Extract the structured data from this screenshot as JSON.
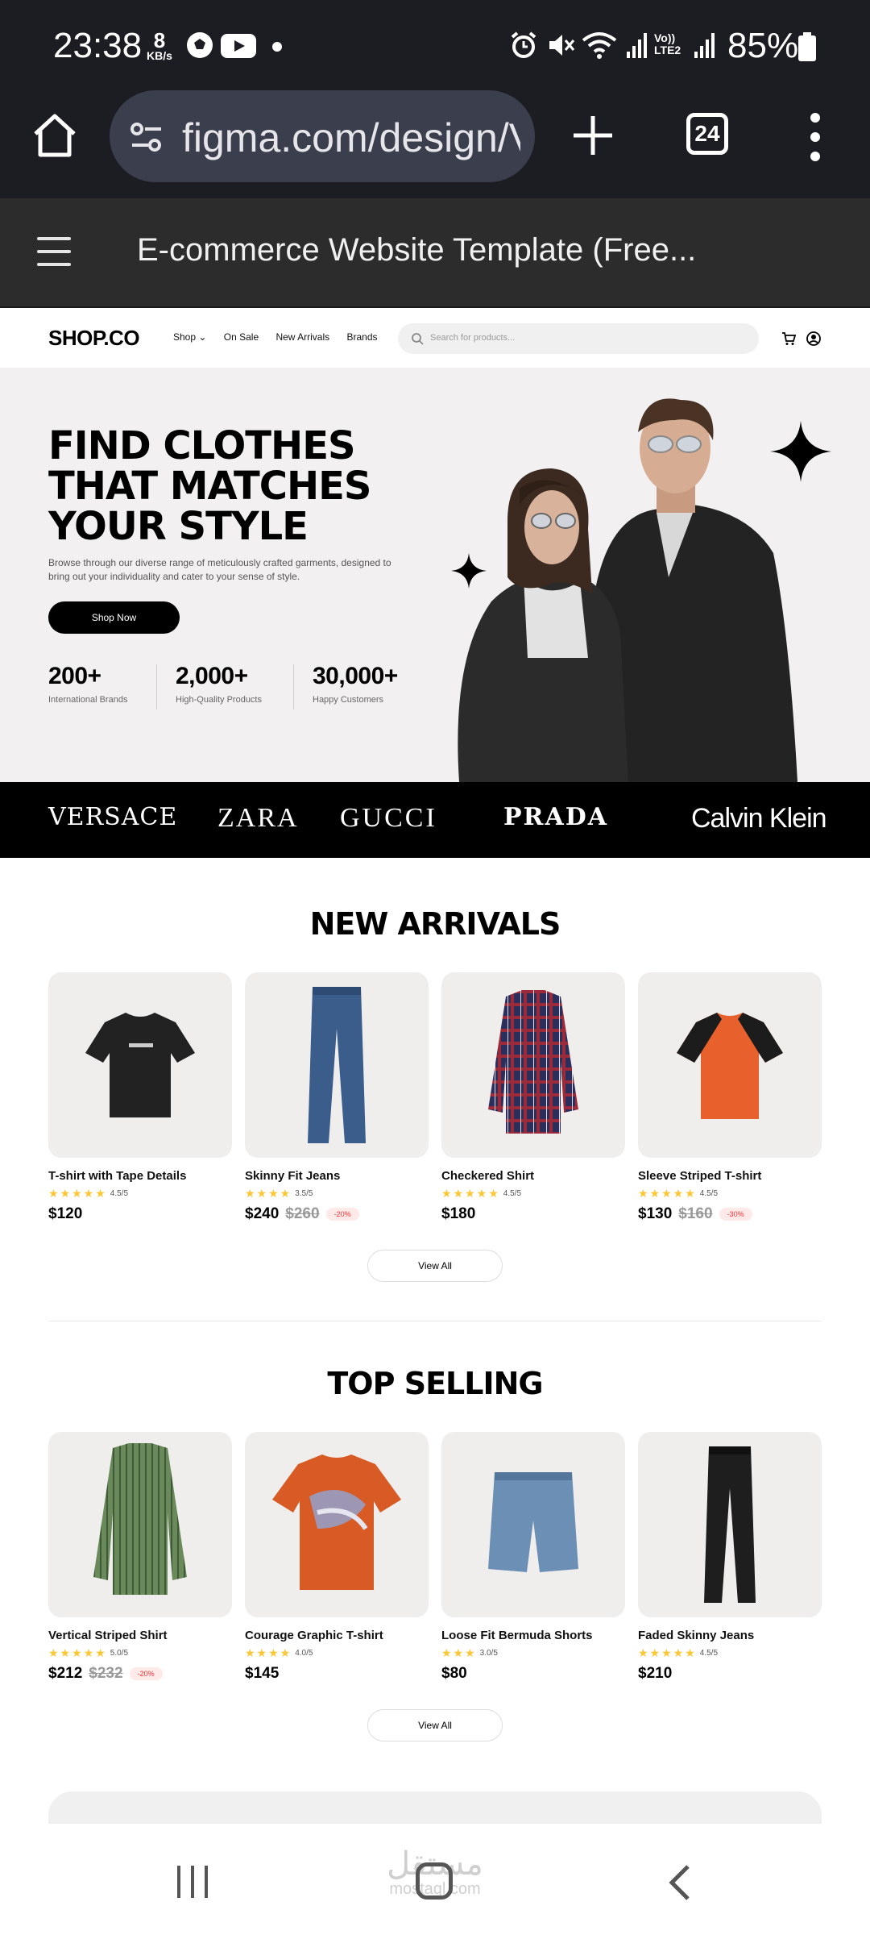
{
  "status_bar": {
    "time": "23:38",
    "speed_value": "8",
    "speed_unit": "KB/s",
    "battery": "85%",
    "network": "LTE2"
  },
  "browser": {
    "url": "figma.com/design/V",
    "tab_count": "24"
  },
  "figma": {
    "file_title": "E-commerce Website Template (Free..."
  },
  "site": {
    "logo": "SHOP.CO",
    "nav": {
      "shop": "Shop",
      "on_sale": "On Sale",
      "new_arrivals": "New Arrivals",
      "brands": "Brands"
    },
    "search_placeholder": "Search for products..."
  },
  "hero": {
    "title_line1": "FIND CLOTHES",
    "title_line2": "THAT MATCHES",
    "title_line3": "YOUR STYLE",
    "description": "Browse through our diverse range of meticulously crafted garments, designed to bring out your individuality and cater to your sense of style.",
    "cta": "Shop Now",
    "stats": [
      {
        "value": "200+",
        "label": "International Brands"
      },
      {
        "value": "2,000+",
        "label": "High-Quality Products"
      },
      {
        "value": "30,000+",
        "label": "Happy Customers"
      }
    ]
  },
  "brands": [
    "VERSACE",
    "ZARA",
    "GUCCI",
    "PRADA",
    "Calvin Klein"
  ],
  "new_arrivals": {
    "title": "NEW ARRIVALS",
    "view_all": "View All",
    "products": [
      {
        "name": "T-shirt with Tape Details",
        "stars": "★★★★★",
        "rating": "4.5/5",
        "price": "$120",
        "old_price": "",
        "discount": ""
      },
      {
        "name": "Skinny Fit Jeans",
        "stars": "★★★★",
        "rating": "3.5/5",
        "price": "$240",
        "old_price": "$260",
        "discount": "-20%"
      },
      {
        "name": "Checkered Shirt",
        "stars": "★★★★★",
        "rating": "4.5/5",
        "price": "$180",
        "old_price": "",
        "discount": ""
      },
      {
        "name": "Sleeve Striped T-shirt",
        "stars": "★★★★★",
        "rating": "4.5/5",
        "price": "$130",
        "old_price": "$160",
        "discount": "-30%"
      }
    ]
  },
  "top_selling": {
    "title": "TOP SELLING",
    "view_all": "View All",
    "products": [
      {
        "name": "Vertical Striped Shirt",
        "stars": "★★★★★",
        "rating": "5.0/5",
        "price": "$212",
        "old_price": "$232",
        "discount": "-20%"
      },
      {
        "name": "Courage Graphic T-shirt",
        "stars": "★★★★",
        "rating": "4.0/5",
        "price": "$145",
        "old_price": "",
        "discount": ""
      },
      {
        "name": "Loose Fit Bermuda Shorts",
        "stars": "★★★",
        "rating": "3.0/5",
        "price": "$80",
        "old_price": "",
        "discount": ""
      },
      {
        "name": "Faded Skinny Jeans",
        "stars": "★★★★★",
        "rating": "4.5/5",
        "price": "$210",
        "old_price": "",
        "discount": ""
      }
    ]
  },
  "watermark": {
    "arabic": "مستقل",
    "latin": "mostaql.com"
  },
  "colors": {
    "accent": "#000000",
    "star": "#ffc633",
    "discount": "#ff3333",
    "card_bg": "#f0eeed",
    "hero_bg": "#f2f0f1"
  }
}
